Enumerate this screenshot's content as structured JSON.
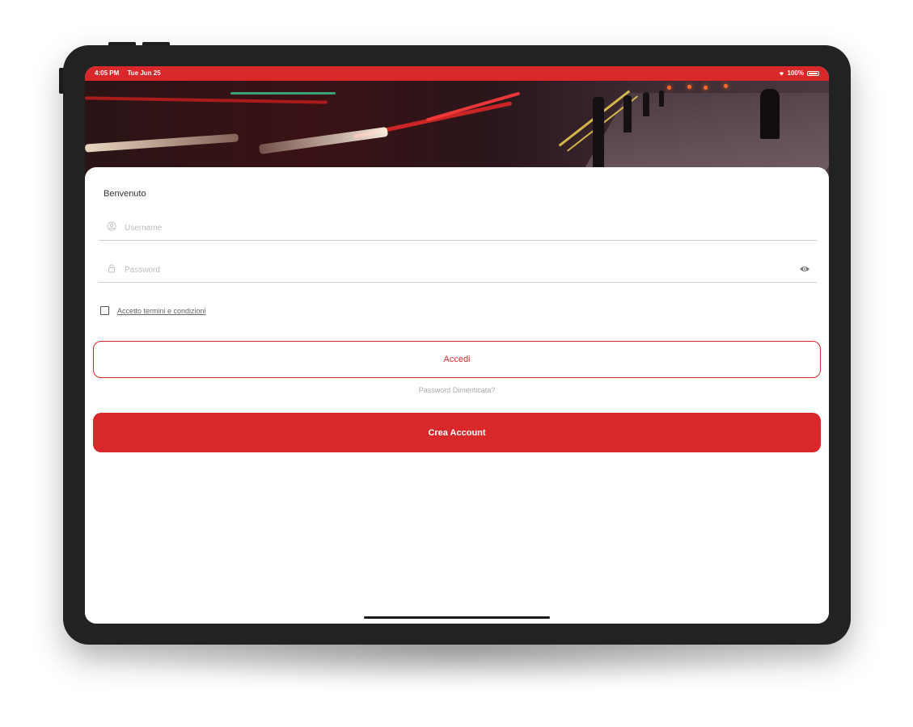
{
  "status_bar": {
    "time": "4:05 PM",
    "date": "Tue Jun 25",
    "battery": "100%",
    "wifi_icon": "wifi-icon",
    "battery_icon": "battery-icon"
  },
  "login": {
    "welcome": "Benvenuto",
    "username_placeholder": "Username",
    "password_placeholder": "Password",
    "terms_label": "Accetto termini e condizioni",
    "terms_checked": false,
    "login_button": "Accedi",
    "forgot_link": "Password Dimenticata?",
    "create_account_button": "Crea Account"
  },
  "colors": {
    "accent": "#d8282a",
    "text": "#333333",
    "placeholder": "#bdbdbd"
  },
  "icons": {
    "username": "user-icon",
    "password": "lock-icon",
    "toggle_visibility": "eye-icon"
  }
}
